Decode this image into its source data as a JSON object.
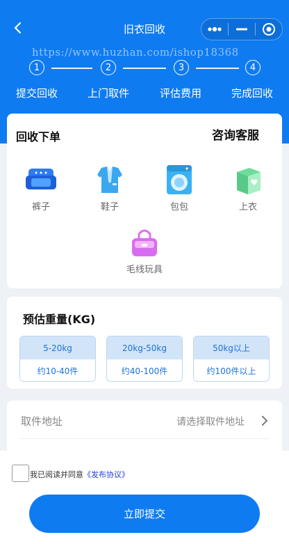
{
  "nav": {
    "title": "旧衣回收",
    "watermark": "https://www.huzhan.com/ishop18368"
  },
  "steps": [
    {
      "number": "1",
      "label": "提交回收"
    },
    {
      "number": "2",
      "label": "上门取件"
    },
    {
      "number": "3",
      "label": "评估费用"
    },
    {
      "number": "4",
      "label": "完成回收"
    }
  ],
  "order_card": {
    "title": "回收下单",
    "service": "咨询客服",
    "categories": [
      {
        "label": "裤子",
        "icon": "sofa-icon",
        "color": "#2f7bf0"
      },
      {
        "label": "鞋子",
        "icon": "suit-icon",
        "color": "#3aa7f0"
      },
      {
        "label": "包包",
        "icon": "washing-machine-icon",
        "color": "#3ab1f2"
      },
      {
        "label": "上衣",
        "icon": "gift-box-icon",
        "color": "#6fdc9b"
      },
      {
        "label": "毛线玩具",
        "icon": "bag-icon",
        "color": "#d86cf0"
      }
    ]
  },
  "weight_card": {
    "title": "预估重量(KG)",
    "options": [
      {
        "range": "5-20kg",
        "items": "约10-40件"
      },
      {
        "range": "20kg-50kg",
        "items": "约40-100件"
      },
      {
        "range": "50kg以上",
        "items": "约100件以上"
      }
    ]
  },
  "address": {
    "label": "取件地址",
    "placeholder": "请选择取件地址"
  },
  "agreement": {
    "text": "我已阅读并同意",
    "link": "《发布协议》"
  },
  "submit_label": "立即提交",
  "colors": {
    "primary": "#0f7bf1",
    "link": "#1f3fd6"
  }
}
